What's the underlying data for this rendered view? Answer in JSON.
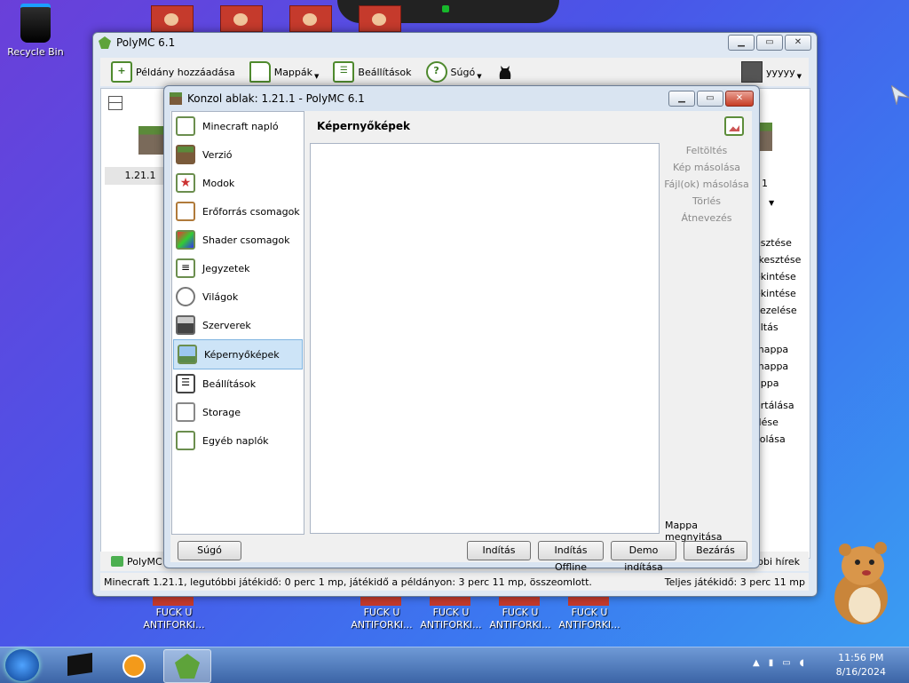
{
  "desktop": {
    "recycle_bin": "Recycle Bin",
    "shortcut_label_line1": "FUCK U",
    "shortcut_label_line2": "ANTIFORKI..."
  },
  "main_window": {
    "title": "PolyMC 6.1",
    "toolbar": {
      "add_instance": "Példány hozzáadása",
      "folders": "Mappák",
      "settings": "Beállítások",
      "help": "Súgó",
      "account": "yyyyy"
    },
    "instance_label": "1.21.1",
    "right_items": [
      "Feltöltés",
      "esztése",
      "rkesztése",
      "ekintése",
      "ekintése",
      "kezelése",
      "áltás",
      "mappa",
      "mappa",
      "appa",
      "ortálása",
      "rlése",
      "solása"
    ],
    "right_value": "1",
    "news_label": "PolyMC h",
    "news_right": "bbi hírek",
    "status_left": "Minecraft 1.21.1, legutóbbi játékidő: 0 perc 1 mp, játékidő a példányon: 3 perc 11 mp, összeomlott.",
    "status_right": "Teljes játékidő: 3 perc 11 mp"
  },
  "console_window": {
    "title": "Konzol ablak: 1.21.1 - PolyMC 6.1",
    "sidebar": [
      {
        "label": "Minecraft napló"
      },
      {
        "label": "Verzió"
      },
      {
        "label": "Modok"
      },
      {
        "label": "Erőforrás csomagok"
      },
      {
        "label": "Shader csomagok"
      },
      {
        "label": "Jegyzetek"
      },
      {
        "label": "Világok"
      },
      {
        "label": "Szerverek"
      },
      {
        "label": "Képernyőképek"
      },
      {
        "label": "Beállítások"
      },
      {
        "label": "Storage"
      },
      {
        "label": "Egyéb naplók"
      }
    ],
    "active_index": 8,
    "panel_title": "Képernyőképek",
    "actions": [
      "Feltöltés",
      "Kép másolása",
      "Fájl(ok) másolása",
      "Törlés",
      "Átnevezés"
    ],
    "open_folder": "Mappa megnyitása",
    "buttons": {
      "help": "Súgó",
      "launch": "Indítás",
      "launch_offline": "Indítás Offline",
      "demo": "Demo indítása",
      "close": "Bezárás"
    }
  },
  "taskbar": {
    "time": "11:56 PM",
    "date": "8/16/2024"
  },
  "colors": {
    "desktop_start": "#6a3fd9",
    "desktop_end": "#3aa0f2",
    "active_item": "#cde4f7",
    "icon_green": "#4f8a2e"
  }
}
